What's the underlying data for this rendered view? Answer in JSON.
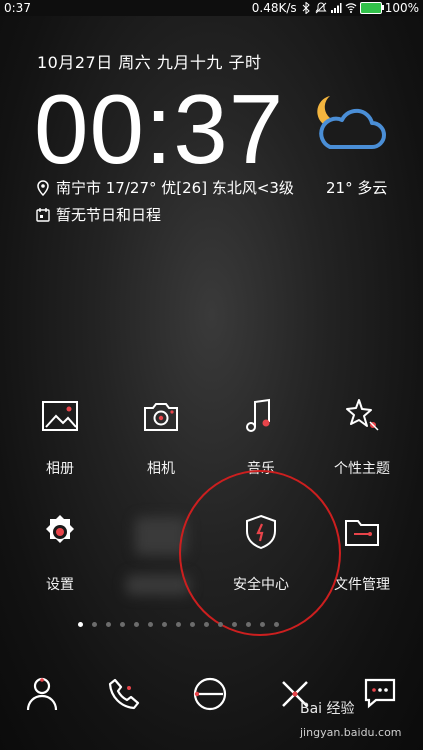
{
  "status_bar": {
    "time": "0:37",
    "net_speed": "0.48K/s",
    "battery": "100%",
    "battery_color": "#31c14a"
  },
  "lockscreen": {
    "date_line": "10月27日  周六  九月十九  子时",
    "clock": "00:37",
    "weather_line": "南宁市 17/27° 优[26] 东北风<3级",
    "current_weather": "21° 多云",
    "calendar_line": "暂无节日和日程",
    "weather_icon": "moon-cloud-icon"
  },
  "apps_row1": [
    {
      "label": "相册",
      "icon": "gallery-icon"
    },
    {
      "label": "相机",
      "icon": "camera-icon"
    },
    {
      "label": "音乐",
      "icon": "music-note-icon"
    },
    {
      "label": "个性主题",
      "icon": "theme-star-icon"
    }
  ],
  "apps_row2": [
    {
      "label": "设置",
      "icon": "settings-gear-icon"
    },
    {
      "label": "安全中心",
      "icon": "security-shield-icon"
    },
    {
      "label": "文件管理",
      "icon": "folder-icon"
    }
  ],
  "page_indicator": {
    "count": 15,
    "active": 0
  },
  "dock": [
    "contacts-icon",
    "phone-icon",
    "browser-icon",
    "tools-icon",
    "messages-icon"
  ],
  "watermark": {
    "text": "Bai 经验",
    "sub": "jingyan.baidu.com"
  },
  "colors": {
    "accent": "#e8444a",
    "annotation": "#cc1f1f"
  }
}
